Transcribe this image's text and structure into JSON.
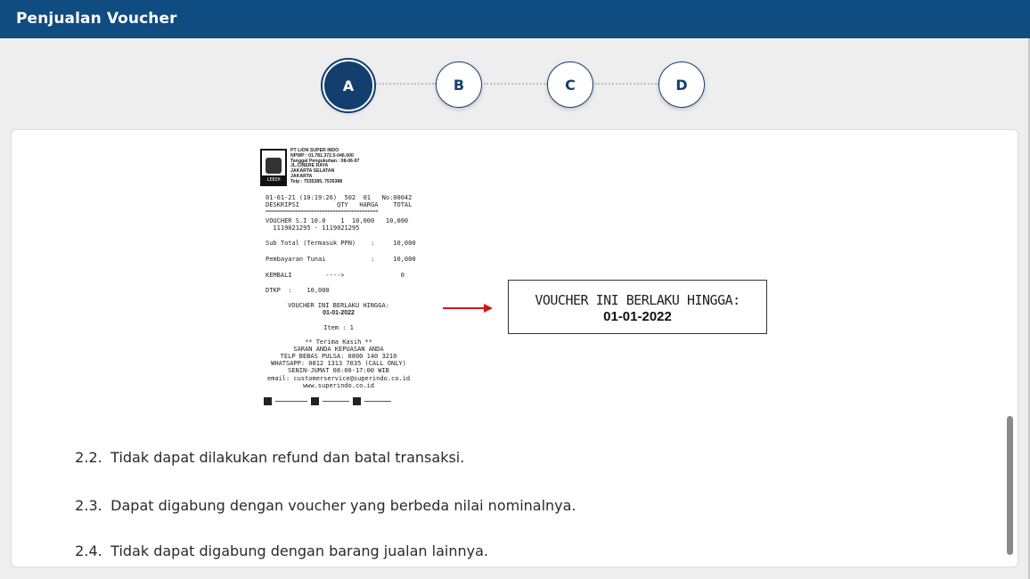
{
  "header": {
    "title": "Penjualan Voucher"
  },
  "stepper": {
    "steps": [
      {
        "label": "A",
        "active": true
      },
      {
        "label": "B",
        "active": false
      },
      {
        "label": "C",
        "active": false
      },
      {
        "label": "D",
        "active": false
      }
    ]
  },
  "receipt": {
    "company": "PT LION SUPER INDO\nNPWP : 01.781.372.5-046.000\nTanggal Pengukuhan : 08-06-97\nJL.CINERE RAYA\nJAKARTA SELATAN\nJAKARTA\nTelp : 7535385, 7535388",
    "logo_text": "LEBIH MURAH",
    "header_line": "01-01-21 (10:19:26)  502  01   No:00042",
    "columns_line": "DESKRIPSI          QTY   HARGA    TOTAL",
    "divider": "==========================================",
    "item_line": "VOUCHER S.I 10.0    1  10,000   10,000",
    "item_serial": "  1119021295 - 1119021295",
    "subtotal_line": "Sub Total (Termasuk PPN)    :     10,000",
    "payment_line": "Pembayaran Tunai            :     10,000",
    "change_line": "KEMBALI         ---->               0",
    "dpp_line": "DTKP  :    10,000",
    "valid_text": "VOUCHER INI BERLAKU HINGGA:",
    "valid_date": "01-01-2022",
    "item_count": "Item : 1",
    "thanks": "** Terima Kasih **",
    "footer1": "SARAN ANDA KEPUASAN ANDA",
    "footer2": "TELP BEBAS PULSA: 0800 140 3210",
    "footer3": "WHATSAPP: 0812 1313 7035 (CALL ONLY)",
    "footer4": "SENIN-JUMAT 08:00-17:00 WIB",
    "footer5": "email: customerservice@superindo.co.id",
    "footer6": "www.superindo.co.id"
  },
  "callout": {
    "line1": "VOUCHER INI BERLAKU HINGGA:",
    "line2": "01-01-2022"
  },
  "items": [
    {
      "num": "2.2.",
      "text": "Tidak dapat dilakukan refund dan batal transaksi."
    },
    {
      "num": "2.3.",
      "text": "Dapat digabung dengan voucher yang berbeda nilai nominalnya."
    },
    {
      "num": "2.4.",
      "text": "Tidak dapat digabung dengan barang jualan lainnya."
    }
  ],
  "colors": {
    "header_bg": "#0f4c81",
    "step_color": "#123f6e",
    "arrow": "#d0171b"
  }
}
